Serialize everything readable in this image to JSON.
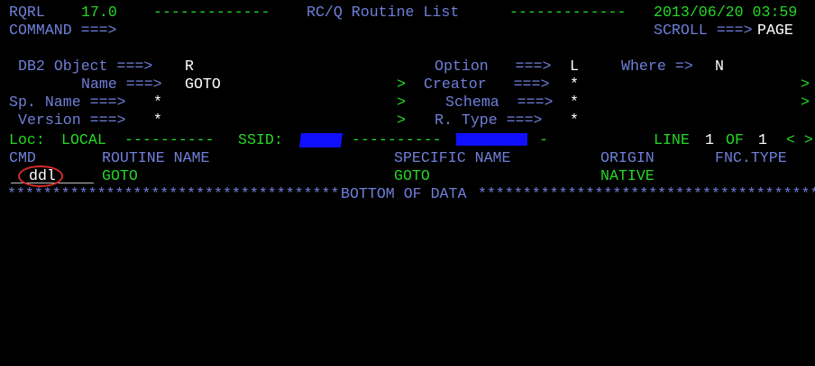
{
  "header": {
    "app": "RQRL",
    "version": "17.0",
    "dashes_left": "-------------",
    "title": "RC/Q Routine List",
    "dashes_right": "-------------",
    "datetime": "2013/06/20 03:59"
  },
  "command": {
    "label": "COMMAND ===>",
    "value": ""
  },
  "scroll": {
    "label": "SCROLL ===>",
    "value": "PAGE"
  },
  "fields": {
    "db2_object": {
      "label": "DB2 Object ===>",
      "value": "R"
    },
    "option": {
      "label": "Option   ===>",
      "value": "L"
    },
    "where": {
      "label": "Where =>",
      "value": "N"
    },
    "name": {
      "label": "Name ===>",
      "value": "GOTO"
    },
    "creator": {
      "label": "Creator   ===>",
      "value": "*"
    },
    "sp_name": {
      "label": "Sp. Name ===>",
      "value": "*"
    },
    "schema": {
      "label": "Schema  ===>",
      "value": "*"
    },
    "version": {
      "label": "Version ===>",
      "value": "*"
    },
    "r_type": {
      "label": "R. Type ===>",
      "value": "*"
    },
    "more_marker": ">"
  },
  "status": {
    "loc_label": "Loc:",
    "loc_value": "LOCAL",
    "dashes1": "----------",
    "ssid_label": "SSID:",
    "dashes2": "----------",
    "dash3": "-",
    "line_label": "LINE",
    "line_value": "1",
    "of_label": "OF",
    "of_value": "1",
    "nav": "< >"
  },
  "table": {
    "headers": {
      "cmd": "CMD",
      "routine_name": "ROUTINE NAME",
      "specific_name": "SPECIFIC NAME",
      "origin": "ORIGIN",
      "fnc_type": "FNC.TYPE"
    },
    "rows": [
      {
        "cmd": "ddl",
        "routine_name": "GOTO",
        "specific_name": "GOTO",
        "origin": "NATIVE",
        "fnc_type": ""
      }
    ]
  },
  "footer": {
    "stars_left": "*************************************",
    "text": "BOTTOM OF DATA",
    "stars_right": "*****************************************"
  },
  "colors": {
    "background": "#000000",
    "label_blue": "#6f7fd8",
    "value_green": "#25d825",
    "input_white": "#ffffff",
    "annotation_red": "#d42a2a",
    "redaction_blue": "#1010ff"
  }
}
